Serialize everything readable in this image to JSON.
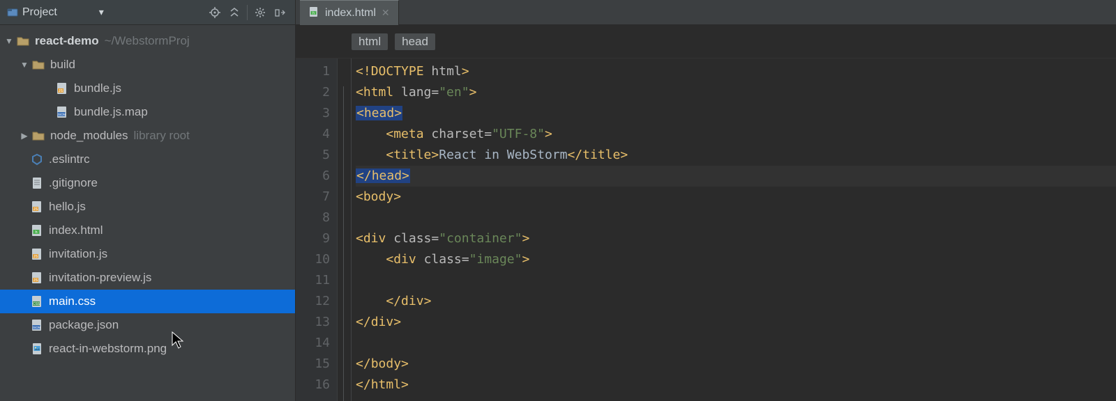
{
  "project_panel": {
    "title": "Project"
  },
  "editor_tabs": [
    {
      "label": "index.html",
      "icon": "html-file-icon"
    }
  ],
  "tree": {
    "root": {
      "name": "react-demo",
      "path": "~/WebstormProj"
    },
    "items": [
      {
        "depth": 1,
        "expandable": true,
        "expanded": true,
        "icon": "folder-icon",
        "name": "build",
        "hint": ""
      },
      {
        "depth": 2,
        "expandable": false,
        "expanded": false,
        "icon": "js-file-icon",
        "name": "bundle.js",
        "hint": ""
      },
      {
        "depth": 2,
        "expandable": false,
        "expanded": false,
        "icon": "json-file-icon",
        "name": "bundle.js.map",
        "hint": ""
      },
      {
        "depth": 1,
        "expandable": true,
        "expanded": false,
        "icon": "folder-icon",
        "name": "node_modules",
        "hint": "library root"
      },
      {
        "depth": 1,
        "expandable": false,
        "expanded": false,
        "icon": "ring-file-icon",
        "name": ".eslintrc",
        "hint": ""
      },
      {
        "depth": 1,
        "expandable": false,
        "expanded": false,
        "icon": "text-file-icon",
        "name": ".gitignore",
        "hint": ""
      },
      {
        "depth": 1,
        "expandable": false,
        "expanded": false,
        "icon": "js-file-icon",
        "name": "hello.js",
        "hint": ""
      },
      {
        "depth": 1,
        "expandable": false,
        "expanded": false,
        "icon": "html-file-icon",
        "name": "index.html",
        "hint": ""
      },
      {
        "depth": 1,
        "expandable": false,
        "expanded": false,
        "icon": "js-file-icon",
        "name": "invitation.js",
        "hint": ""
      },
      {
        "depth": 1,
        "expandable": false,
        "expanded": false,
        "icon": "js-file-icon",
        "name": "invitation-preview.js",
        "hint": ""
      },
      {
        "depth": 1,
        "expandable": false,
        "expanded": false,
        "icon": "css-file-icon",
        "name": "main.css",
        "hint": "",
        "selected": true
      },
      {
        "depth": 1,
        "expandable": false,
        "expanded": false,
        "icon": "json-file-icon",
        "name": "package.json",
        "hint": ""
      },
      {
        "depth": 1,
        "expandable": false,
        "expanded": false,
        "icon": "image-file-icon",
        "name": "react-in-webstorm.png",
        "hint": ""
      }
    ]
  },
  "breadcrumbs": [
    "html",
    "head"
  ],
  "editor": {
    "current_line": 6,
    "lines": [
      {
        "n": 1,
        "tokens": [
          [
            "bracket",
            "<!"
          ],
          [
            "tag",
            "DOCTYPE "
          ],
          [
            "attr",
            "html"
          ],
          [
            "bracket",
            ">"
          ]
        ]
      },
      {
        "n": 2,
        "tokens": [
          [
            "bracket",
            "<"
          ],
          [
            "tag",
            "html "
          ],
          [
            "attr",
            "lang="
          ],
          [
            "str",
            "\"en\""
          ],
          [
            "bracket",
            ">"
          ]
        ]
      },
      {
        "n": 3,
        "hl": true,
        "tokens": [
          [
            "bracket",
            "<"
          ],
          [
            "tag",
            "head"
          ],
          [
            "bracket",
            ">"
          ]
        ]
      },
      {
        "n": 4,
        "indent": "    ",
        "tokens": [
          [
            "bracket",
            "<"
          ],
          [
            "tag",
            "meta "
          ],
          [
            "attr",
            "charset="
          ],
          [
            "str",
            "\"UTF-8\""
          ],
          [
            "bracket",
            ">"
          ]
        ]
      },
      {
        "n": 5,
        "indent": "    ",
        "tokens": [
          [
            "bracket",
            "<"
          ],
          [
            "tag",
            "title"
          ],
          [
            "bracket",
            ">"
          ],
          [
            "text",
            "React in WebStorm"
          ],
          [
            "bracket",
            "</"
          ],
          [
            "tag",
            "title"
          ],
          [
            "bracket",
            ">"
          ]
        ]
      },
      {
        "n": 6,
        "hl": true,
        "tokens": [
          [
            "bracket",
            "</"
          ],
          [
            "tag",
            "head"
          ],
          [
            "bracket",
            ">"
          ]
        ]
      },
      {
        "n": 7,
        "tokens": [
          [
            "bracket",
            "<"
          ],
          [
            "tag",
            "body"
          ],
          [
            "bracket",
            ">"
          ]
        ]
      },
      {
        "n": 8,
        "tokens": []
      },
      {
        "n": 9,
        "tokens": [
          [
            "bracket",
            "<"
          ],
          [
            "tag",
            "div "
          ],
          [
            "attr",
            "class="
          ],
          [
            "str",
            "\"container\""
          ],
          [
            "bracket",
            ">"
          ]
        ]
      },
      {
        "n": 10,
        "indent": "    ",
        "tokens": [
          [
            "bracket",
            "<"
          ],
          [
            "tag",
            "div "
          ],
          [
            "attr",
            "class="
          ],
          [
            "str",
            "\"image\""
          ],
          [
            "bracket",
            ">"
          ]
        ]
      },
      {
        "n": 11,
        "tokens": []
      },
      {
        "n": 12,
        "indent": "    ",
        "tokens": [
          [
            "bracket",
            "</"
          ],
          [
            "tag",
            "div"
          ],
          [
            "bracket",
            ">"
          ]
        ]
      },
      {
        "n": 13,
        "tokens": [
          [
            "bracket",
            "</"
          ],
          [
            "tag",
            "div"
          ],
          [
            "bracket",
            ">"
          ]
        ]
      },
      {
        "n": 14,
        "tokens": []
      },
      {
        "n": 15,
        "tokens": [
          [
            "bracket",
            "</"
          ],
          [
            "tag",
            "body"
          ],
          [
            "bracket",
            ">"
          ]
        ]
      },
      {
        "n": 16,
        "tokens": [
          [
            "bracket",
            "</"
          ],
          [
            "tag",
            "html"
          ],
          [
            "bracket",
            ">"
          ]
        ]
      }
    ]
  }
}
